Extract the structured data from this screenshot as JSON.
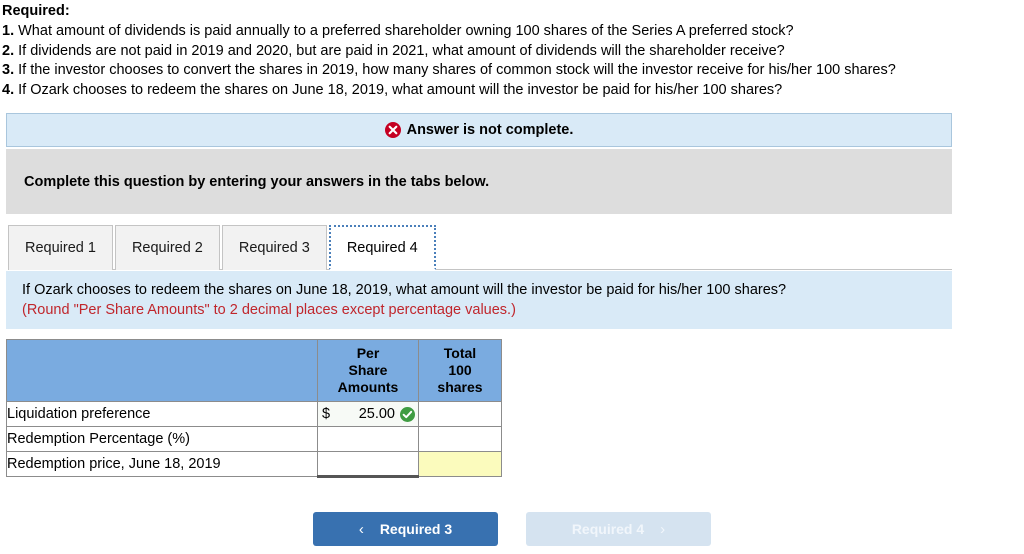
{
  "prompt": {
    "title": "Required:",
    "items": [
      {
        "num": "1.",
        "text": "What amount of dividends is paid annually to a preferred shareholder owning 100 shares of the Series A preferred stock?"
      },
      {
        "num": "2.",
        "text": "If dividends are not paid in 2019 and 2020, but are paid in 2021, what amount of dividends will the shareholder receive?"
      },
      {
        "num": "3.",
        "text": "If the investor chooses to convert the shares in 2019, how many shares of common stock will the investor receive for his/her 100 shares?"
      },
      {
        "num": "4.",
        "text": "If Ozark chooses to redeem the shares on June 18, 2019, what amount will the investor be paid for his/her 100 shares?"
      }
    ]
  },
  "answer_banner": {
    "icon": "error-x-icon",
    "text": "Answer is not complete.",
    "background": "#d9eaf7",
    "icon_color": "#c50022"
  },
  "grey_strip": {
    "text": "Complete this question by entering your answers in the tabs below.",
    "background": "#dddddd"
  },
  "tabs": [
    {
      "label": "Required 1",
      "active": false
    },
    {
      "label": "Required 2",
      "active": false
    },
    {
      "label": "Required 3",
      "active": false
    },
    {
      "label": "Required 4",
      "active": true
    }
  ],
  "question_panel": {
    "question": "If Ozark chooses to redeem the shares on June 18, 2019, what amount will the investor be paid for his/her 100 shares?",
    "round_note": "(Round \"Per Share Amounts\" to 2 decimal places except percentage values.)",
    "background": "#d9eaf7",
    "note_color": "#c0262c"
  },
  "table": {
    "header_background": "#7aabe0",
    "headers": {
      "label": "",
      "per_share": "Per Share Amounts",
      "per_share_lines": [
        "Per",
        "Share",
        "Amounts"
      ],
      "total": "Total 100 shares",
      "total_lines": [
        "Total",
        "100",
        "shares"
      ]
    },
    "rows": [
      {
        "label": "Liquidation preference",
        "per_share": {
          "currency": "$",
          "value": "25.00",
          "validated": true,
          "icon": "check-circle-icon"
        },
        "total": {
          "value": "",
          "highlight": false
        }
      },
      {
        "label": "Redemption Percentage (%)",
        "per_share": {
          "currency": "",
          "value": "",
          "validated": false
        },
        "total": {
          "value": "",
          "highlight": false
        }
      },
      {
        "label": "Redemption price, June 18, 2019",
        "per_share": {
          "currency": "",
          "value": "",
          "validated": false,
          "total_line": true
        },
        "total": {
          "value": "",
          "highlight": true
        }
      }
    ],
    "highlight_color": "#fbfbbd",
    "check_color": "#3f9c42"
  },
  "nav": {
    "prev": {
      "label": "Required 3",
      "icon": "chevron-left-icon",
      "glyph": "‹",
      "enabled": true,
      "color": "#3871b0"
    },
    "next": {
      "label": "Required 4",
      "icon": "chevron-right-icon",
      "glyph": "›",
      "enabled": false,
      "color": "#d5e3f0"
    }
  }
}
